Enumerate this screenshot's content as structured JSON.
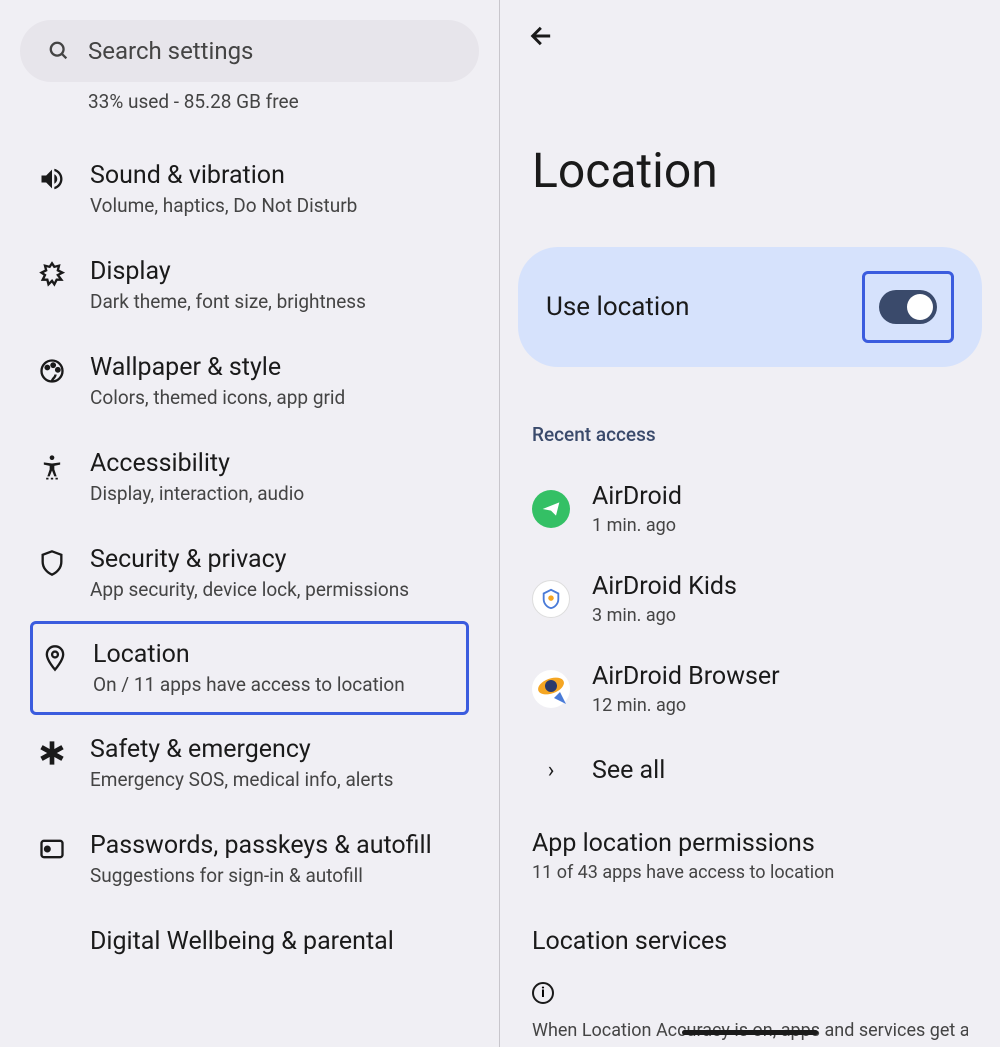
{
  "search": {
    "placeholder": "Search settings"
  },
  "storage_info": "33% used - 85.28 GB free",
  "sidebar": {
    "items": [
      {
        "title": "Sound & vibration",
        "subtitle": "Volume, haptics, Do Not Disturb",
        "icon": "volume"
      },
      {
        "title": "Display",
        "subtitle": "Dark theme, font size, brightness",
        "icon": "brightness"
      },
      {
        "title": "Wallpaper & style",
        "subtitle": "Colors, themed icons, app grid",
        "icon": "palette"
      },
      {
        "title": "Accessibility",
        "subtitle": "Display, interaction, audio",
        "icon": "accessibility"
      },
      {
        "title": "Security & privacy",
        "subtitle": "App security, device lock, permissions",
        "icon": "shield"
      },
      {
        "title": "Location",
        "subtitle": "On / 11 apps have access to location",
        "icon": "location",
        "highlighted": true
      },
      {
        "title": "Safety & emergency",
        "subtitle": "Emergency SOS, medical info, alerts",
        "icon": "asterisk"
      },
      {
        "title": "Passwords, passkeys & autofill",
        "subtitle": "Suggestions for sign-in & autofill",
        "icon": "key"
      },
      {
        "title": "Digital Wellbeing & parental",
        "subtitle": "",
        "icon": "wellbeing"
      }
    ]
  },
  "detail": {
    "page_title": "Location",
    "toggle_label": "Use location",
    "toggle_on": true,
    "recent_header": "Recent access",
    "recent_apps": [
      {
        "name": "AirDroid",
        "time": "1 min. ago"
      },
      {
        "name": "AirDroid Kids",
        "time": "3 min. ago"
      },
      {
        "name": "AirDroid Browser",
        "time": "12 min. ago"
      }
    ],
    "see_all": "See all",
    "permissions": {
      "title": "App location permissions",
      "subtitle": "11 of 43 apps have access to location"
    },
    "services_header": "Location services",
    "truncated": "When Location Accuracy is on, apps and services get a"
  }
}
